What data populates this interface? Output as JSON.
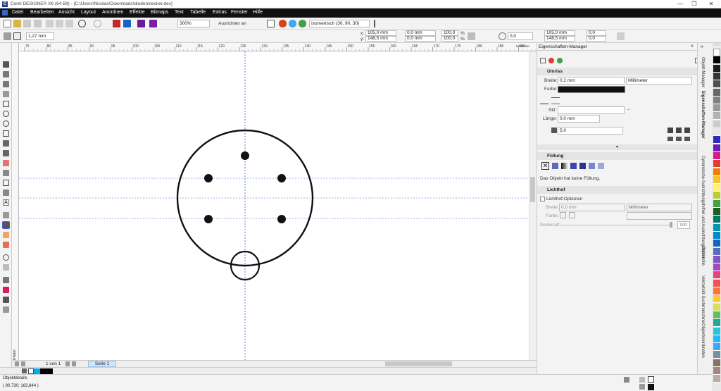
{
  "window": {
    "title": "Corel DESIGNER X6 (64 Bit) - [C:\\Users\\Nicolas\\Downloads\\diodenstecker.des]",
    "min_label": "—",
    "max_label": "❐",
    "close_label": "✕"
  },
  "menu": [
    "Datei",
    "Bearbeiten",
    "Ansicht",
    "Layout",
    "Anordnen",
    "Effekte",
    "Bitmaps",
    "Text",
    "Tabelle",
    "Extras",
    "Fenster",
    "Hilfe"
  ],
  "toolbar": {
    "zoom": "300%",
    "align_label": "Ausrichten an",
    "projection": "Isometrisch (30, 90, 30)"
  },
  "propbar": {
    "outline_width": "1,27 mm",
    "x_label": "x:",
    "x_value": "105,0 mm",
    "y_label": "y:",
    "y_value": "148,5 mm",
    "w_value": "0,0 mm",
    "h_value": "0,0 mm",
    "scale_w": "100,0",
    "scale_h": "100,0",
    "pct1": "%",
    "pct2": "%",
    "angle": "0,0",
    "pos_x2": "105,0 mm",
    "pos_y2": "148,5 mm",
    "extra1": "0,0",
    "extra2": "0,0"
  },
  "ruler": {
    "ticks": [
      "75",
      "80",
      "85",
      "90",
      "95",
      "100",
      "105",
      "110",
      "115",
      "120",
      "125",
      "130",
      "135",
      "140",
      "145",
      "150",
      "155",
      "160",
      "165",
      "170",
      "175",
      "180",
      "185",
      "190",
      "195"
    ],
    "unit": "Millimeter",
    "vunit": "Millimeter"
  },
  "pages": {
    "counter": "1 von 1",
    "tab": "Seite 1"
  },
  "status": {
    "info": "Objektdetails",
    "coords": "( 90,730; 163,844 )"
  },
  "docker": {
    "title": "Eigenschaften-Manager",
    "outline": {
      "header": "Umriss",
      "width_label": "Breite:",
      "width_value": "0,2 mm",
      "unit_value": "Millimeter",
      "color_label": "Farbe:",
      "style_label": "Stil:",
      "length_label": "Länge:",
      "length_value": "0,0 mm",
      "miter_value": "5,0",
      "more": "..."
    },
    "fill": {
      "header": "Füllung",
      "info": "Das Objekt hat keine Füllung."
    },
    "halo": {
      "header": "Lichthof",
      "options_label": "Lichthof-Optionen",
      "width_label": "Breite:",
      "width_value": "0,0 mm",
      "unit_value": "Millimeter",
      "color_label": "Farbe:",
      "opacity_label": "Deckkraft:",
      "opacity_value": "100"
    }
  },
  "side_tabs": [
    "Objekt-Manager",
    "Eigenschaften-Manager",
    "Dynamische Ausrichtungshilfen und Ausrichtungshilfen",
    "Objektstile",
    "Vektorbild-Suchmaschine",
    "Objektkoordinaten"
  ],
  "colors": {
    "accent_red": "#e53935",
    "canvas_bg": "#ffffff",
    "guide": "#3b5bd6",
    "menubar": "#111111"
  },
  "palette": [
    "#ffffff",
    "#000000",
    "#1a1a1a",
    "#333333",
    "#4d4d4d",
    "#666666",
    "#808080",
    "#999999",
    "#b3b3b3",
    "#cccccc",
    "#e6e6e6",
    "#2d2dbb",
    "#6a1bb5",
    "#d81b8a",
    "#e53935",
    "#f57c00",
    "#fbc02d",
    "#fff176",
    "#c0ca33",
    "#43a047",
    "#1b5e20",
    "#00796b",
    "#0097a7",
    "#0288d1",
    "#1565c0",
    "#5c6bc0",
    "#7e57c2",
    "#ab47bc",
    "#ec407a",
    "#ef5350",
    "#ff7043",
    "#ffca28",
    "#d4e157",
    "#66bb6a",
    "#26a69a",
    "#26c6da",
    "#29b6f6",
    "#42a5f5",
    "#78909c",
    "#8d6e63",
    "#a1887f",
    "#bcaaa4"
  ]
}
